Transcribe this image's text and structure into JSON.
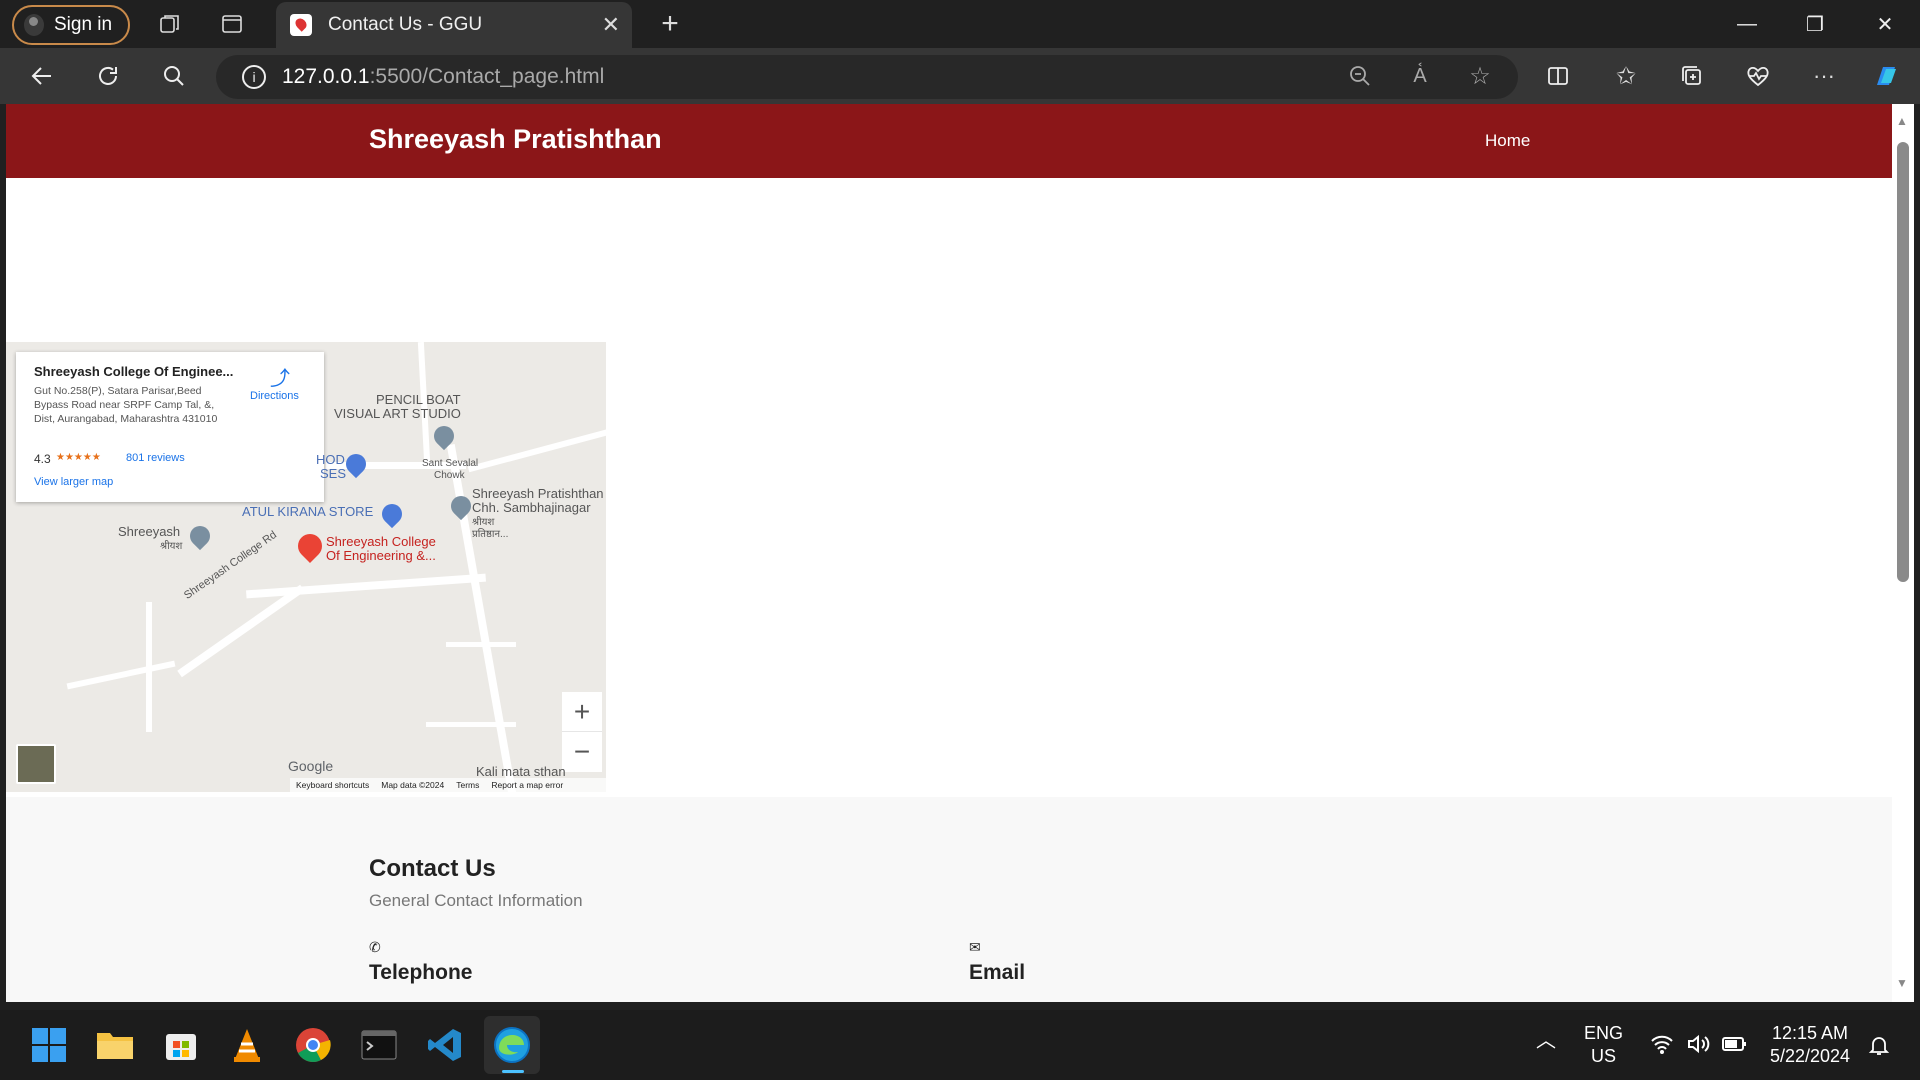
{
  "browser": {
    "sign_in": "Sign in",
    "tab_title": "Contact Us - GGU",
    "url_host": "127.0.0.1",
    "url_rest": ":5500/Contact_page.html"
  },
  "site": {
    "brand": "Shreeyash Pratishthan",
    "nav_home": "Home"
  },
  "map": {
    "card_title": "Shreeyash College Of Enginee...",
    "card_address": "Gut No.258(P), Satara Parisar,Beed Bypass Road near SRPF Camp Tal, &, Dist, Aurangabad, Maharashtra 431010",
    "rating": "4.3",
    "stars": "★★★★★",
    "reviews": "801 reviews",
    "directions": "Directions",
    "view_larger": "View larger map",
    "labels": {
      "pencil_boat": "PENCIL BOAT",
      "visual_art": "VISUAL ART STUDIO",
      "hod": "HOD",
      "ses": "SES",
      "sant_sevalal": "Sant Sevalal",
      "chowk": "Chowk",
      "atul_kirana": "ATUL KIRANA STORE",
      "pratishthan_1": "Shreeyash Pratishthan",
      "pratishthan_2": "Chh. Sambhajinagar",
      "pratishthan_3": "श्रीयश",
      "pratishthan_4": "प्रतिष्ठान...",
      "shreeyash": "Shreeyash",
      "shreeyash_marathi": "श्रीयश",
      "college_1": "Shreeyash College",
      "college_2": "Of Engineering &...",
      "college_rd": "Shreeyash College Rd",
      "kali_mata": "Kali mata sthan"
    },
    "google": "Google",
    "footer_keyboard": "Keyboard shortcuts",
    "footer_data": "Map data ©2024",
    "footer_terms": "Terms",
    "footer_report": "Report a map error",
    "zoom_in": "+",
    "zoom_out": "−"
  },
  "contact": {
    "title": "Contact Us",
    "subtitle": "General Contact Information",
    "telephone": "Telephone",
    "email": "Email"
  },
  "tray": {
    "lang1": "ENG",
    "lang2": "US",
    "time": "12:15 AM",
    "date": "5/22/2024"
  },
  "colors": {
    "navbar": "#8b1618",
    "browser_dark": "#202020"
  }
}
